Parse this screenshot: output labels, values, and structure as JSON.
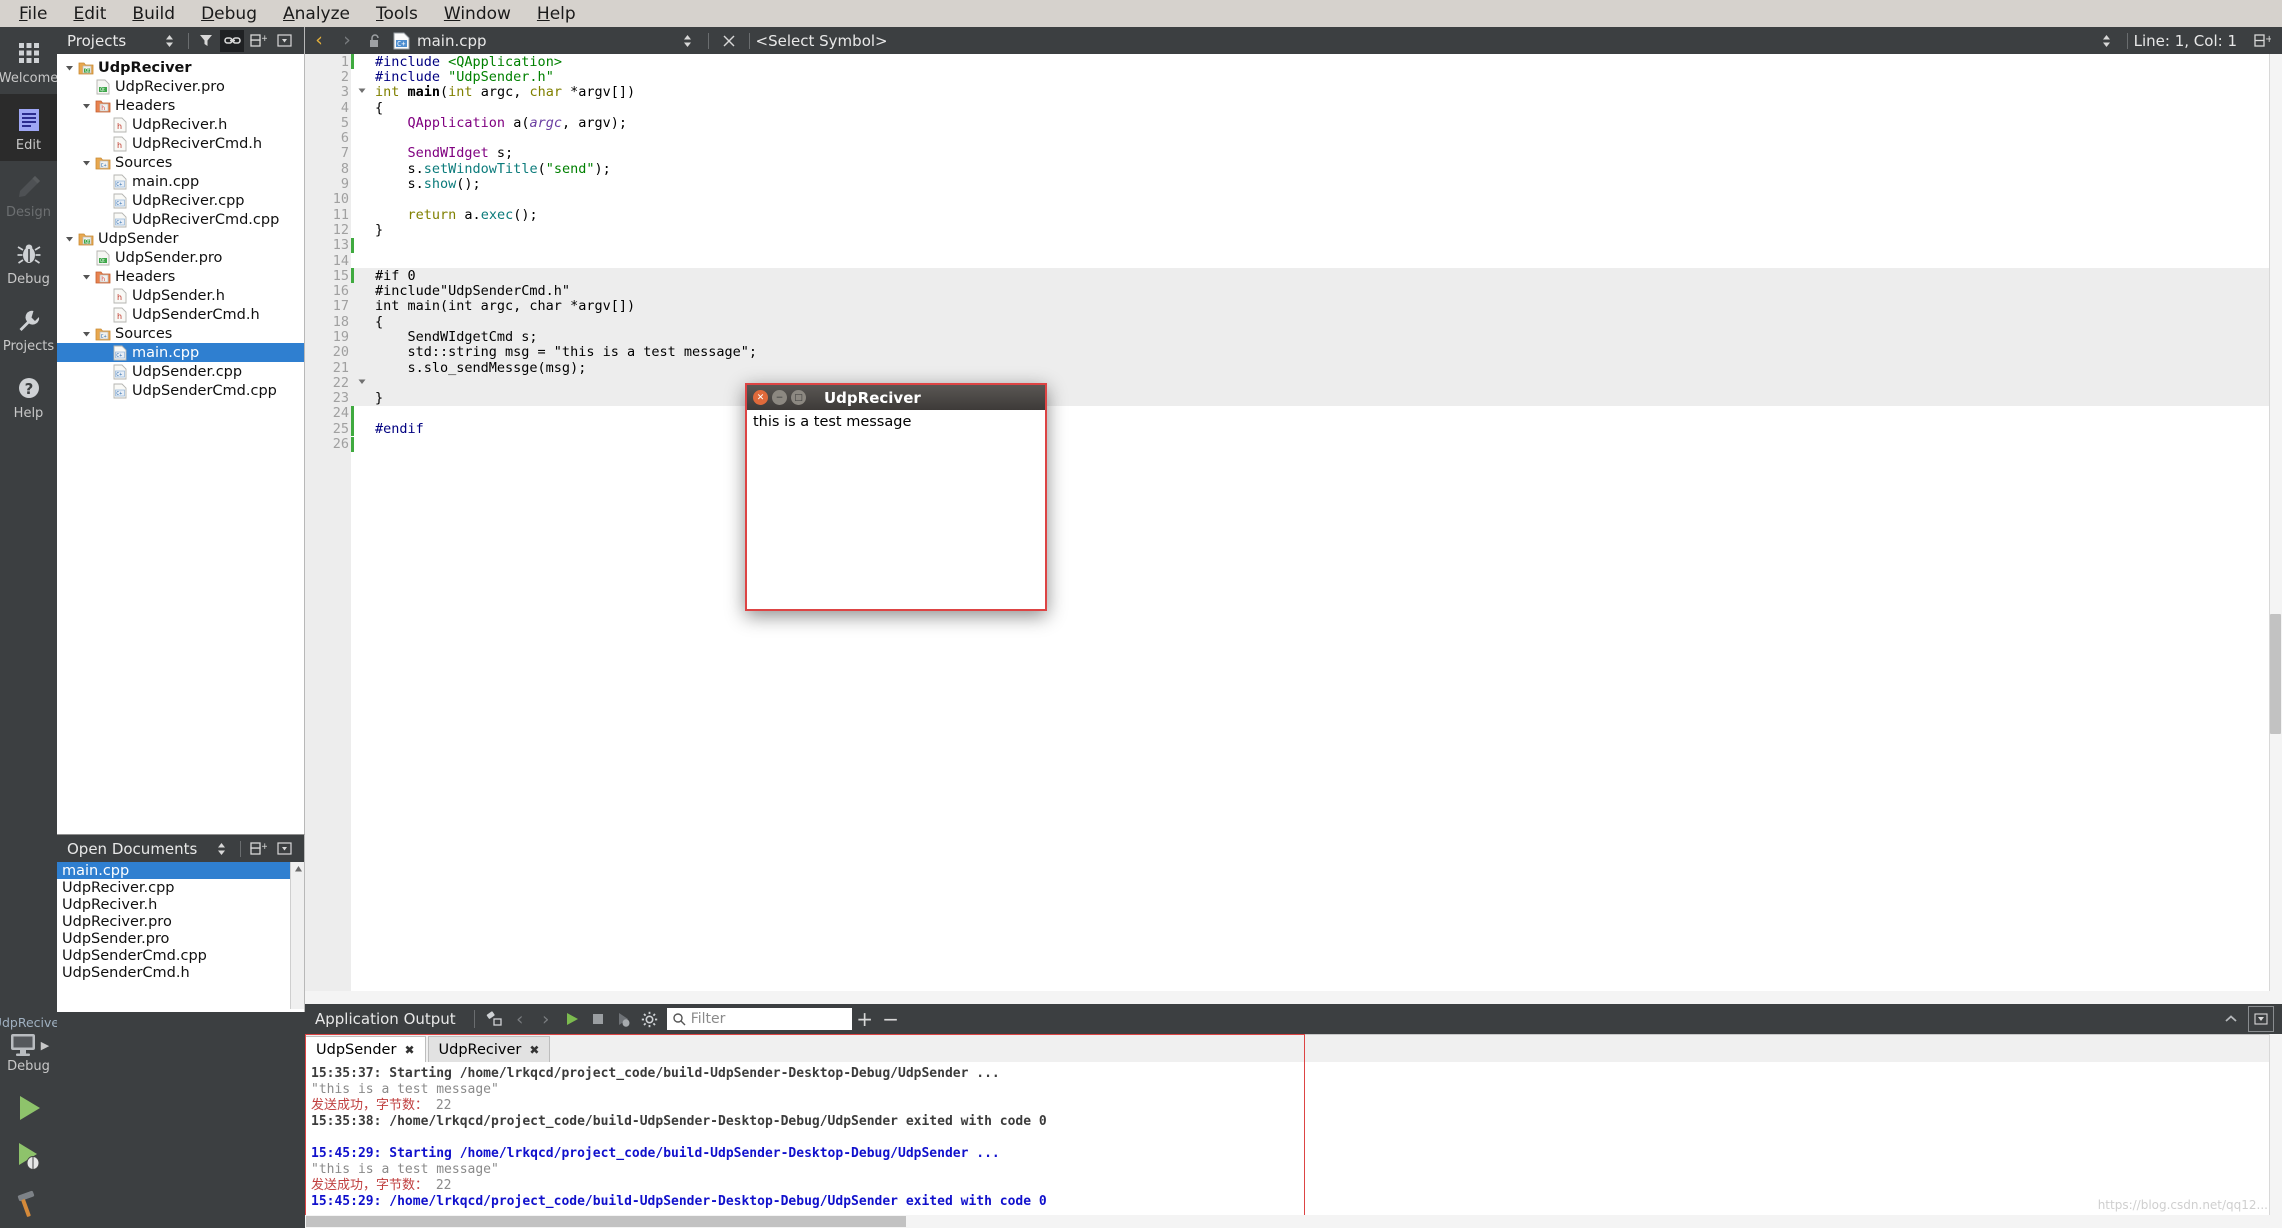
{
  "menubar": {
    "items": [
      {
        "label": "File",
        "mnemonic": "F"
      },
      {
        "label": "Edit",
        "mnemonic": "E"
      },
      {
        "label": "Build",
        "mnemonic": "B"
      },
      {
        "label": "Debug",
        "mnemonic": "D"
      },
      {
        "label": "Analyze",
        "mnemonic": "A"
      },
      {
        "label": "Tools",
        "mnemonic": "T"
      },
      {
        "label": "Window",
        "mnemonic": "W"
      },
      {
        "label": "Help",
        "mnemonic": "H"
      }
    ]
  },
  "modebar": {
    "modes": [
      {
        "label": "Welcome",
        "icon": "grid-icon",
        "state": "normal"
      },
      {
        "label": "Edit",
        "icon": "document-lines-icon",
        "state": "active"
      },
      {
        "label": "Design",
        "icon": "pencil-icon",
        "state": "disabled"
      },
      {
        "label": "Debug",
        "icon": "bug-icon",
        "state": "normal"
      },
      {
        "label": "Projects",
        "icon": "wrench-icon",
        "state": "normal"
      },
      {
        "label": "Help",
        "icon": "question-circle-icon",
        "state": "normal"
      }
    ],
    "run_config": {
      "kit_name": "UdpReciver",
      "build_config": "Debug",
      "buttons": [
        "run-button",
        "start-debugging-button",
        "build-button"
      ]
    }
  },
  "projects_pane": {
    "title": "Projects",
    "header_buttons": [
      "sort-toggle-icon",
      "filter-icon",
      "link-with-editor-icon",
      "split-icon",
      "close-icon"
    ],
    "tree": [
      {
        "depth": 0,
        "label": "UdpReciver",
        "icon": "qt-project-icon",
        "expander": "down",
        "bold": true,
        "selected": false
      },
      {
        "depth": 1,
        "label": "UdpReciver.pro",
        "icon": "qt-pro-file-icon",
        "expander": "none",
        "bold": false,
        "selected": false
      },
      {
        "depth": 1,
        "label": "Headers",
        "icon": "headers-folder-icon",
        "expander": "down",
        "bold": false,
        "selected": false
      },
      {
        "depth": 2,
        "label": "UdpReciver.h",
        "icon": "h-file-icon",
        "expander": "none",
        "bold": false,
        "selected": false
      },
      {
        "depth": 2,
        "label": "UdpReciverCmd.h",
        "icon": "h-file-icon",
        "expander": "none",
        "bold": false,
        "selected": false
      },
      {
        "depth": 1,
        "label": "Sources",
        "icon": "sources-folder-icon",
        "expander": "down",
        "bold": false,
        "selected": false
      },
      {
        "depth": 2,
        "label": "main.cpp",
        "icon": "cpp-file-icon",
        "expander": "none",
        "bold": false,
        "selected": false
      },
      {
        "depth": 2,
        "label": "UdpReciver.cpp",
        "icon": "cpp-file-icon",
        "expander": "none",
        "bold": false,
        "selected": false
      },
      {
        "depth": 2,
        "label": "UdpReciverCmd.cpp",
        "icon": "cpp-file-icon",
        "expander": "none",
        "bold": false,
        "selected": false
      },
      {
        "depth": 0,
        "label": "UdpSender",
        "icon": "qt-project-icon",
        "expander": "down",
        "bold": false,
        "selected": false
      },
      {
        "depth": 1,
        "label": "UdpSender.pro",
        "icon": "qt-pro-file-icon",
        "expander": "none",
        "bold": false,
        "selected": false
      },
      {
        "depth": 1,
        "label": "Headers",
        "icon": "headers-folder-icon",
        "expander": "down",
        "bold": false,
        "selected": false
      },
      {
        "depth": 2,
        "label": "UdpSender.h",
        "icon": "h-file-icon",
        "expander": "none",
        "bold": false,
        "selected": false
      },
      {
        "depth": 2,
        "label": "UdpSenderCmd.h",
        "icon": "h-file-icon",
        "expander": "none",
        "bold": false,
        "selected": false
      },
      {
        "depth": 1,
        "label": "Sources",
        "icon": "sources-folder-icon",
        "expander": "down",
        "bold": false,
        "selected": false
      },
      {
        "depth": 2,
        "label": "main.cpp",
        "icon": "cpp-file-icon",
        "expander": "none",
        "bold": false,
        "selected": true
      },
      {
        "depth": 2,
        "label": "UdpSender.cpp",
        "icon": "cpp-file-icon",
        "expander": "none",
        "bold": false,
        "selected": false
      },
      {
        "depth": 2,
        "label": "UdpSenderCmd.cpp",
        "icon": "cpp-file-icon",
        "expander": "none",
        "bold": false,
        "selected": false
      }
    ]
  },
  "open_documents": {
    "title": "Open Documents",
    "header_buttons": [
      "sort-toggle-icon",
      "split-icon",
      "close-icon"
    ],
    "items": [
      {
        "label": "main.cpp",
        "selected": true
      },
      {
        "label": "UdpReciver.cpp",
        "selected": false
      },
      {
        "label": "UdpReciver.h",
        "selected": false
      },
      {
        "label": "UdpReciver.pro",
        "selected": false
      },
      {
        "label": "UdpSender.pro",
        "selected": false
      },
      {
        "label": "UdpSenderCmd.cpp",
        "selected": false
      },
      {
        "label": "UdpSenderCmd.h",
        "selected": false
      }
    ]
  },
  "editor_toolbar": {
    "back_label": "‹",
    "forward_label": "›",
    "filename": "main.cpp",
    "file_icon": "cpp-file-icon",
    "lock_icon": "unlocked-icon",
    "symbol_selector": "<Select Symbol>",
    "line_col": "Line: 1, Col: 1",
    "split_icon": "split-icon",
    "close_icon": "close-icon"
  },
  "editor": {
    "lines": [
      {
        "n": 1,
        "cursor": true,
        "fold": "",
        "shade": false,
        "tokens": [
          {
            "t": "#include ",
            "c": "k-preb"
          },
          {
            "t": "<QApplication>",
            "c": "k-str"
          }
        ]
      },
      {
        "n": 2,
        "cursor": false,
        "fold": "",
        "shade": false,
        "tokens": [
          {
            "t": "#include ",
            "c": "k-preb"
          },
          {
            "t": "\"UdpSender.h\"",
            "c": "k-str"
          }
        ]
      },
      {
        "n": 3,
        "cursor": false,
        "fold": "down",
        "shade": false,
        "tokens": [
          {
            "t": "int ",
            "c": "k-kw"
          },
          {
            "t": "main",
            "c": "k-fn"
          },
          {
            "t": "(",
            "c": "k-plain"
          },
          {
            "t": "int",
            "c": "k-kw"
          },
          {
            "t": " argc, ",
            "c": "k-plain"
          },
          {
            "t": "char",
            "c": "k-kw"
          },
          {
            "t": " *argv[])",
            "c": "k-plain"
          }
        ]
      },
      {
        "n": 4,
        "cursor": false,
        "fold": "",
        "shade": false,
        "tokens": [
          {
            "t": "{",
            "c": "k-plain"
          }
        ]
      },
      {
        "n": 5,
        "cursor": false,
        "fold": "",
        "shade": false,
        "tokens": [
          {
            "t": "    ",
            "c": "k-plain"
          },
          {
            "t": "QApplication",
            "c": "k-type"
          },
          {
            "t": " a(",
            "c": "k-plain"
          },
          {
            "t": "argc",
            "c": "k-param"
          },
          {
            "t": ", argv);",
            "c": "k-plain"
          }
        ]
      },
      {
        "n": 6,
        "cursor": false,
        "fold": "",
        "shade": false,
        "tokens": []
      },
      {
        "n": 7,
        "cursor": false,
        "fold": "",
        "shade": false,
        "tokens": [
          {
            "t": "    ",
            "c": "k-plain"
          },
          {
            "t": "SendWIdget",
            "c": "k-type"
          },
          {
            "t": " s;",
            "c": "k-plain"
          }
        ]
      },
      {
        "n": 8,
        "cursor": false,
        "fold": "",
        "shade": false,
        "tokens": [
          {
            "t": "    s.",
            "c": "k-plain"
          },
          {
            "t": "setWindowTitle",
            "c": "k-mem"
          },
          {
            "t": "(",
            "c": "k-plain"
          },
          {
            "t": "\"send\"",
            "c": "k-str"
          },
          {
            "t": ");",
            "c": "k-plain"
          }
        ]
      },
      {
        "n": 9,
        "cursor": false,
        "fold": "",
        "shade": false,
        "tokens": [
          {
            "t": "    s.",
            "c": "k-plain"
          },
          {
            "t": "show",
            "c": "k-mem"
          },
          {
            "t": "();",
            "c": "k-plain"
          }
        ]
      },
      {
        "n": 10,
        "cursor": false,
        "fold": "",
        "shade": false,
        "tokens": []
      },
      {
        "n": 11,
        "cursor": false,
        "fold": "",
        "shade": false,
        "tokens": [
          {
            "t": "    ",
            "c": "k-plain"
          },
          {
            "t": "return",
            "c": "k-kw"
          },
          {
            "t": " a.",
            "c": "k-plain"
          },
          {
            "t": "exec",
            "c": "k-mem"
          },
          {
            "t": "();",
            "c": "k-plain"
          }
        ]
      },
      {
        "n": 12,
        "cursor": false,
        "fold": "",
        "shade": false,
        "tokens": [
          {
            "t": "}",
            "c": "k-plain"
          }
        ]
      },
      {
        "n": 13,
        "cursor": true,
        "fold": "",
        "shade": false,
        "tokens": []
      },
      {
        "n": 14,
        "cursor": false,
        "fold": "",
        "shade": false,
        "tokens": []
      },
      {
        "n": 15,
        "cursor": true,
        "fold": "",
        "shade": true,
        "tokens": [
          {
            "t": "#if 0",
            "c": "k-plain"
          }
        ]
      },
      {
        "n": 16,
        "cursor": false,
        "fold": "",
        "shade": true,
        "tokens": [
          {
            "t": "#include\"UdpSenderCmd.h\"",
            "c": "k-plain"
          }
        ]
      },
      {
        "n": 17,
        "cursor": false,
        "fold": "",
        "shade": true,
        "tokens": [
          {
            "t": "int main(int argc, char *argv[])",
            "c": "k-plain"
          }
        ]
      },
      {
        "n": 18,
        "cursor": false,
        "fold": "",
        "shade": true,
        "tokens": [
          {
            "t": "{",
            "c": "k-plain"
          }
        ]
      },
      {
        "n": 19,
        "cursor": false,
        "fold": "",
        "shade": true,
        "tokens": [
          {
            "t": "    SendWIdgetCmd s;",
            "c": "k-plain"
          }
        ]
      },
      {
        "n": 20,
        "cursor": false,
        "fold": "",
        "shade": true,
        "tokens": [
          {
            "t": "    std::string msg = \"this is a test message\";",
            "c": "k-plain"
          }
        ]
      },
      {
        "n": 21,
        "cursor": false,
        "fold": "",
        "shade": true,
        "tokens": [
          {
            "t": "    s.slo_sendMessge(msg);",
            "c": "k-plain"
          }
        ]
      },
      {
        "n": 22,
        "cursor": false,
        "fold": "down",
        "shade": true,
        "tokens": []
      },
      {
        "n": 23,
        "cursor": false,
        "fold": "",
        "shade": true,
        "tokens": [
          {
            "t": "}",
            "c": "k-plain"
          }
        ]
      },
      {
        "n": 24,
        "cursor": true,
        "fold": "",
        "shade": false,
        "tokens": []
      },
      {
        "n": 25,
        "cursor": true,
        "fold": "",
        "shade": false,
        "tokens": [
          {
            "t": "#endif",
            "c": "k-preb"
          }
        ]
      },
      {
        "n": 26,
        "cursor": true,
        "fold": "",
        "shade": false,
        "tokens": []
      }
    ]
  },
  "dialog": {
    "title": "UdpReciver",
    "buttons": [
      "close-button",
      "minimize-button",
      "maximize-button"
    ],
    "content": "this is a test message"
  },
  "output_panel": {
    "title": "Application Output",
    "toolbar_icons": [
      "clear-output-icon",
      "previous-item-icon",
      "next-item-icon",
      "run-icon",
      "stop-icon",
      "attach-debugger-icon",
      "settings-gear-icon"
    ],
    "filter_placeholder": "Filter",
    "zoom_in_label": "+",
    "zoom_out_label": "−",
    "collapse_icon": "chevron-up-icon",
    "menu_icon": "panel-menu-icon",
    "tabs": [
      {
        "label": "UdpSender",
        "active": true
      },
      {
        "label": "UdpReciver",
        "active": false
      }
    ],
    "log": [
      {
        "segments": [
          {
            "t": "15:35:37: Starting /home/lrkqcd/project_code/build-UdpSender-Desktop-Debug/UdpSender ...",
            "c": "lg-start-grey"
          }
        ]
      },
      {
        "segments": [
          {
            "t": "\"this is a test message\"",
            "c": "lg-quote"
          }
        ]
      },
      {
        "segments": [
          {
            "t": "发送成功，字节数：",
            "c": "lg-cn"
          },
          {
            "t": " 22",
            "c": "lg-num"
          }
        ]
      },
      {
        "segments": [
          {
            "t": "15:35:38: /home/lrkqcd/project_code/build-UdpSender-Desktop-Debug/UdpSender exited with code 0",
            "c": "lg-exit-grey"
          }
        ]
      },
      {
        "segments": [
          {
            "t": "",
            "c": "lg-quote"
          }
        ]
      },
      {
        "segments": [
          {
            "t": "15:45:29: Starting /home/lrkqcd/project_code/build-UdpSender-Desktop-Debug/UdpSender ...",
            "c": "lg-blue"
          }
        ]
      },
      {
        "segments": [
          {
            "t": "\"this is a test message\"",
            "c": "lg-quote"
          }
        ]
      },
      {
        "segments": [
          {
            "t": "发送成功，字节数：",
            "c": "lg-cn"
          },
          {
            "t": " 22",
            "c": "lg-num"
          }
        ]
      },
      {
        "segments": [
          {
            "t": "15:45:29: /home/lrkqcd/project_code/build-UdpSender-Desktop-Debug/UdpSender exited with code 0",
            "c": "lg-blue"
          }
        ]
      }
    ]
  },
  "watermark": "https://blog.csdn.net/qq12...",
  "colors": {
    "accent_blue": "#2f7fd0",
    "panel_dark": "#3c3f41",
    "menubar_bg": "#d6d2cd",
    "highlight_red": "#dd4444",
    "gutter_bg": "#ededed"
  }
}
